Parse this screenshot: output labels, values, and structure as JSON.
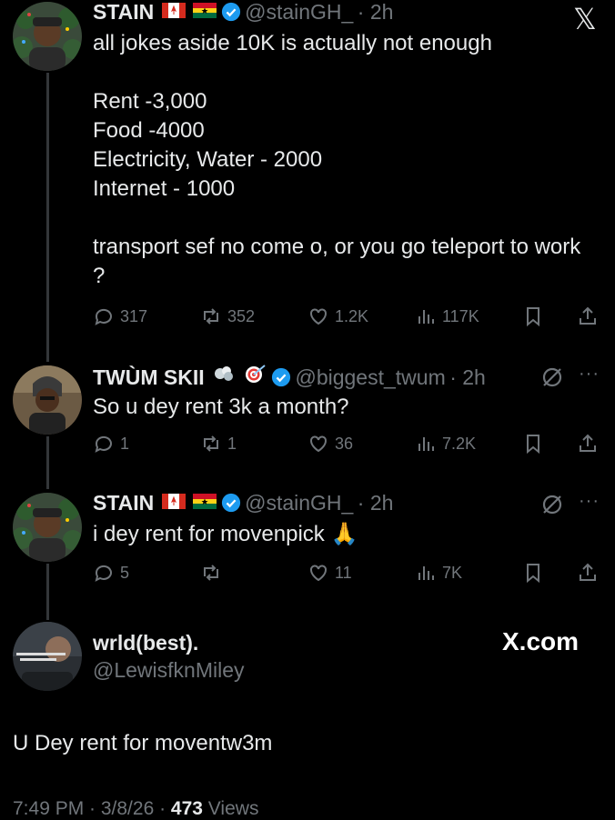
{
  "close_icon_glyph": "𝕏",
  "posts": [
    {
      "name": "STAIN",
      "handle": "@stainGH_",
      "time": "· 2h",
      "text": "all jokes aside 10K is actually not enough\n\nRent -3,000\nFood -4000\nElectricity, Water - 2000\nInternet - 1000\n\ntransport sef no come o, or you go teleport to work ?",
      "replies": "317",
      "reposts": "352",
      "likes": "1.2K",
      "views": "117K"
    },
    {
      "name": "TWÙM SKII",
      "handle": "@biggest_twum",
      "time": "· 2h",
      "text": "So u dey rent 3k a month?",
      "replies": "1",
      "reposts": "1",
      "likes": "36",
      "views": "7.2K"
    },
    {
      "name": "STAIN",
      "handle": "@stainGH_",
      "time": "· 2h",
      "text": "i dey rent for movenpick 🙏",
      "replies": "5",
      "reposts": "",
      "likes": "11",
      "views": "7K"
    }
  ],
  "main_post": {
    "name": "wrld(best).",
    "handle": "@LewisfknMiley",
    "text": "U Dey rent for moventw3m",
    "time": "7:49 PM · 3/8/26 · ",
    "views_count": "473",
    "views_label": " Views"
  },
  "watermark": "X.com",
  "colors": {
    "accent": "#1d9bf0",
    "muted": "#71767b",
    "text": "#e7e9ea"
  }
}
